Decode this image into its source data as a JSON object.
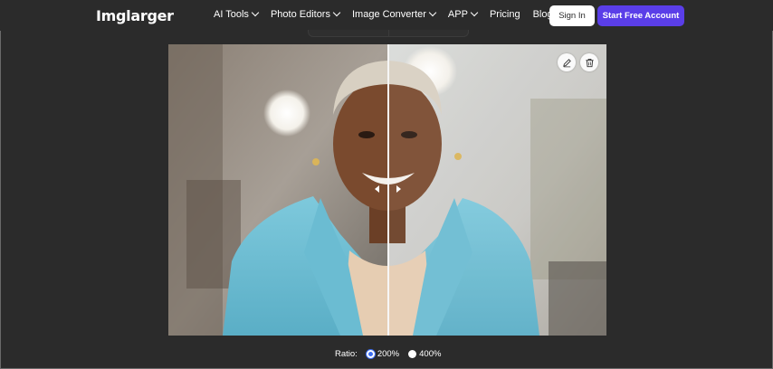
{
  "header": {
    "logo_text": "Imglarger",
    "nav": [
      {
        "label": "AI Tools",
        "dropdown": true
      },
      {
        "label": "Photo Editors",
        "dropdown": true
      },
      {
        "label": "Image Converter",
        "dropdown": true
      },
      {
        "label": "APP",
        "dropdown": true
      },
      {
        "label": "Pricing",
        "dropdown": false
      },
      {
        "label": "Blog",
        "dropdown": false
      }
    ],
    "signin_label": "Sign In",
    "start_label": "Start Free Account"
  },
  "preview": {
    "edit_icon": "pencil-icon",
    "delete_icon": "trash-icon"
  },
  "ratio": {
    "label": "Ratio:",
    "options": [
      "200%",
      "400%"
    ],
    "selected": "200%"
  },
  "colors": {
    "accent": "#5a3ee8",
    "background": "#2b2b2b",
    "radio_selected": "#3c6df0"
  }
}
